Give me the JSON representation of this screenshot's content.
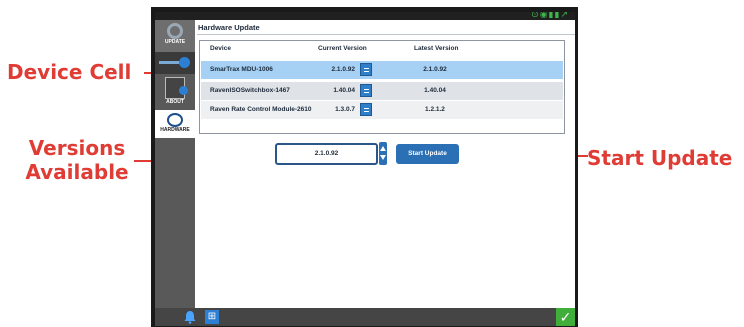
{
  "callouts": {
    "device_cell": "Device Cell",
    "versions_available_line1": "Versions",
    "versions_available_line2": "Available",
    "start_update": "Start Update"
  },
  "sidebar": {
    "items": [
      {
        "label": "UPDATE",
        "icon": "gear-icon"
      },
      {
        "label": "",
        "icon": "key-icon"
      },
      {
        "label": "ABOUT",
        "icon": "info-icon"
      },
      {
        "label": "HARDWARE",
        "icon": "hardware-icon",
        "active": true
      }
    ]
  },
  "page": {
    "title": "Hardware Update"
  },
  "table": {
    "headers": [
      "Device",
      "Current Version",
      "Latest Version"
    ],
    "rows": [
      {
        "device": "SmarTrax MDU-1006",
        "current": "2.1.0.92",
        "latest": "2.1.0.92",
        "selected": true
      },
      {
        "device": "RavenISOSwitchbox-1467",
        "current": "1.40.04",
        "latest": "1.40.04"
      },
      {
        "device": "Raven Rate Control Module-2610",
        "current": "1.3.0.7",
        "latest": "1.2.1.2"
      }
    ]
  },
  "versions": {
    "label_line1": "Versions",
    "label_line2": "Available",
    "value": "2.1.0.92"
  },
  "actions": {
    "start_update": "Start Update"
  },
  "colors": {
    "accent": "#2b6fb5",
    "callout": "#e03c36",
    "selected_row": "#a7d1f4",
    "confirm": "#3fae3a"
  }
}
